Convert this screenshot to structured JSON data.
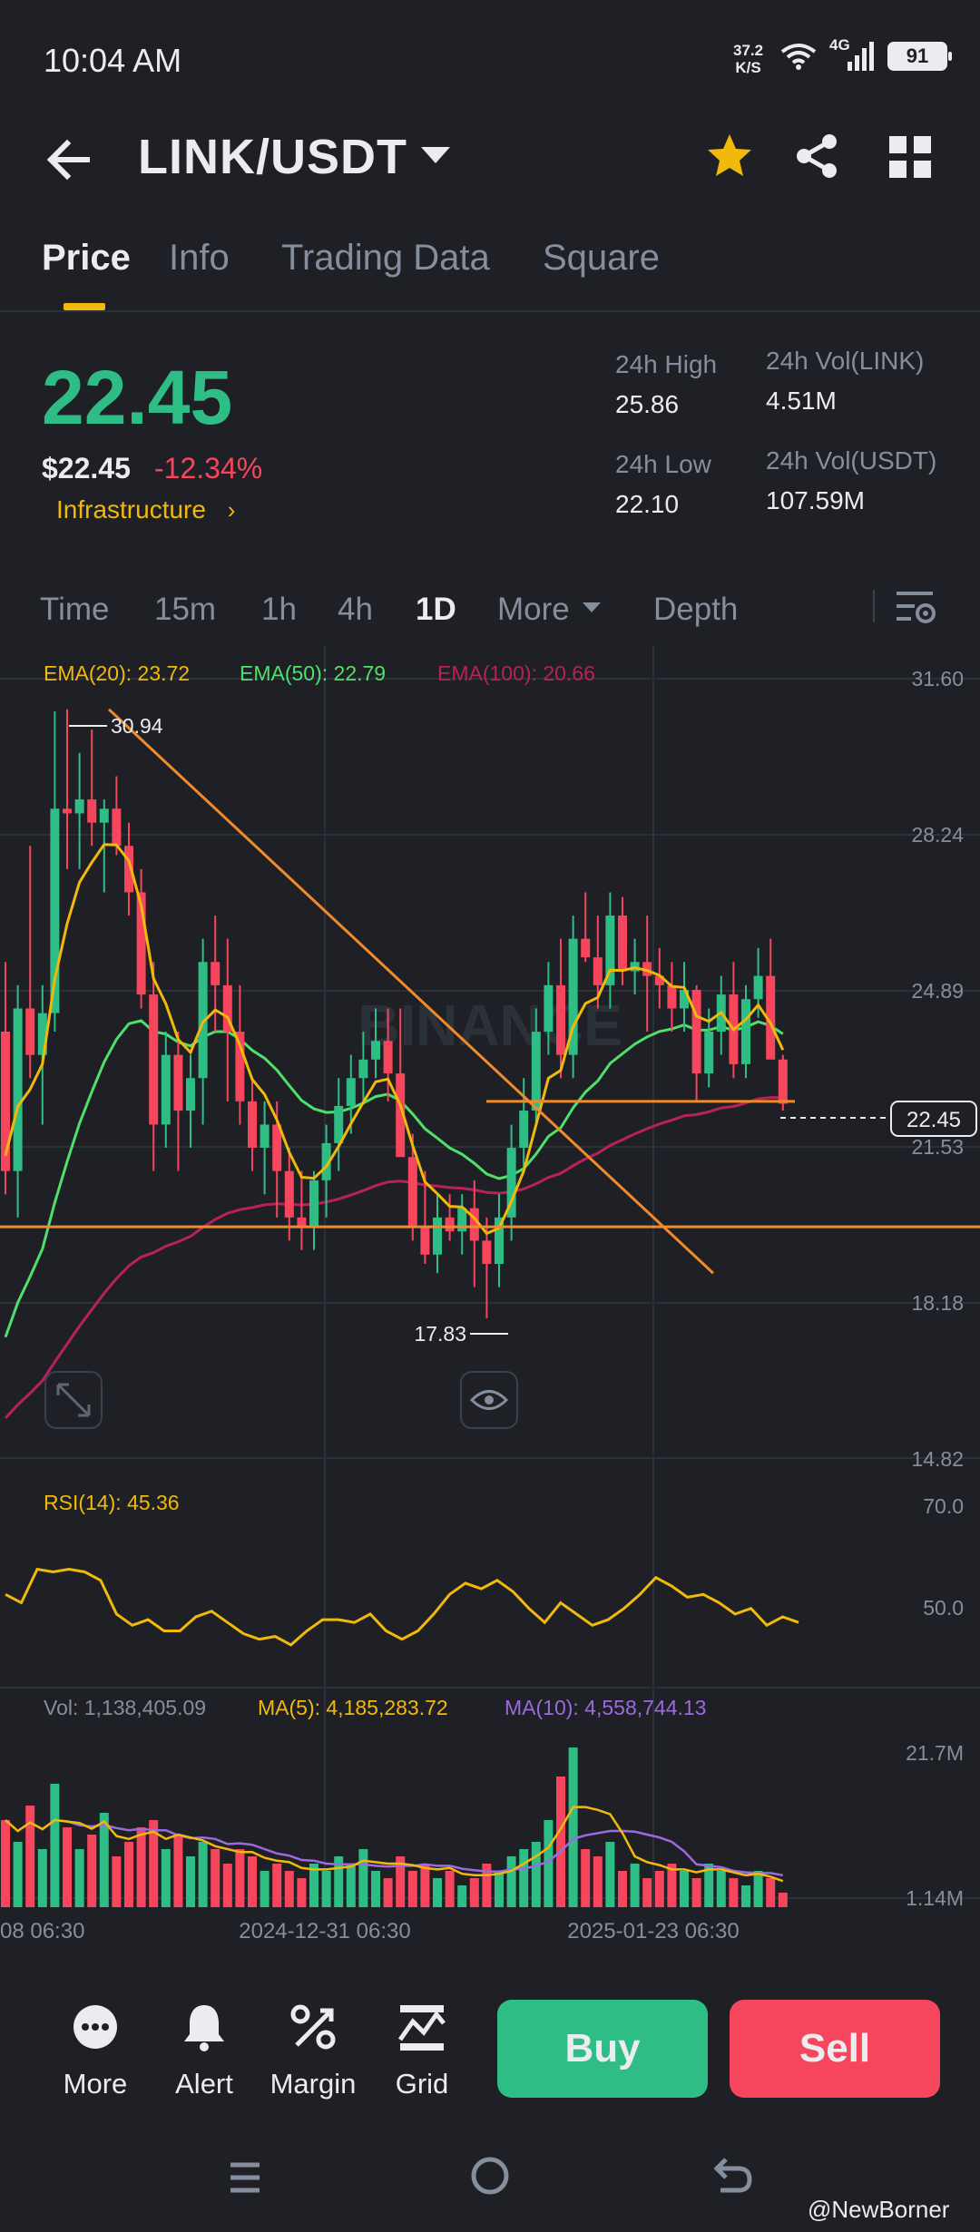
{
  "status_bar": {
    "time": "10:04 AM",
    "net_speed_value": "37.2",
    "net_speed_unit": "K/S",
    "network": "4G",
    "battery": "91",
    "icons": [
      "wifi-icon",
      "signal-icon",
      "battery-icon"
    ]
  },
  "header": {
    "pair": "LINK/USDT",
    "icons": [
      "back-arrow-icon",
      "caret-down-icon",
      "star-icon",
      "share-icon",
      "grid-icon"
    ],
    "favorite_color": "#f0b90b"
  },
  "tabs": [
    {
      "label": "Price",
      "active": true
    },
    {
      "label": "Info"
    },
    {
      "label": "Trading Data"
    },
    {
      "label": "Square"
    }
  ],
  "price": {
    "last": "22.45",
    "usd": "$22.45",
    "change": "-12.34%",
    "category": "Infrastructure"
  },
  "stats": {
    "high_label": "24h High",
    "high": "25.86",
    "low_label": "24h Low",
    "low": "22.10",
    "vol_link_label": "24h Vol(LINK)",
    "vol_link": "4.51M",
    "vol_usdt_label": "24h Vol(USDT)",
    "vol_usdt": "107.59M"
  },
  "intervals": {
    "items": [
      "Time",
      "15m",
      "1h",
      "4h",
      "1D",
      "More",
      "Depth"
    ],
    "active": "1D"
  },
  "colors": {
    "up": "#2ebd85",
    "down": "#f6465d",
    "accent": "#f0b90b",
    "ema20": "#f0b90b",
    "ema50": "#4ee06a",
    "ema100": "#b8215a",
    "rsi": "#f0b90b",
    "ma10": "#9c6ade",
    "trendline": "#f28a2b"
  },
  "indicators": {
    "ema20": "EMA(20): 23.72",
    "ema50": "EMA(50): 22.79",
    "ema100": "EMA(100): 20.66",
    "rsi": "RSI(14): 45.36",
    "vol": "Vol: 1,138,405.09",
    "ma5": "MA(5): 4,185,283.72",
    "ma10": "MA(10): 4,558,744.13"
  },
  "chart_labels": {
    "price_axis": [
      "31.60",
      "28.24",
      "24.89",
      "21.53",
      "18.18",
      "14.82"
    ],
    "current_price": "22.45",
    "high_marker": "30.94",
    "low_marker": "17.83",
    "rsi_axis": [
      "70.0",
      "50.0"
    ],
    "vol_axis": [
      "21.7M",
      "1.14M"
    ],
    "time_axis": [
      "08 06:30",
      "2024-12-31 06:30",
      "2025-01-23 06:30"
    ],
    "watermark": "BINANCE"
  },
  "chart_data": {
    "type": "candlestick",
    "title": "LINK/USDT 1D",
    "ylim": [
      14.82,
      31.6
    ],
    "x": [
      "08 06:30",
      "2024-12-31 06:30",
      "2025-01-23 06:30"
    ],
    "candles": [
      [
        24.0,
        25.5,
        20.5,
        21.0
      ],
      [
        21.0,
        25.0,
        20.0,
        24.5
      ],
      [
        24.5,
        28.0,
        23.0,
        23.5
      ],
      [
        23.5,
        25.0,
        22.0,
        24.4
      ],
      [
        24.4,
        30.9,
        24.0,
        28.8
      ],
      [
        28.8,
        30.94,
        27.5,
        28.7
      ],
      [
        28.7,
        30.0,
        27.5,
        29.0
      ],
      [
        29.0,
        30.5,
        28.0,
        28.5
      ],
      [
        28.5,
        29.0,
        27.0,
        28.8
      ],
      [
        28.8,
        29.5,
        27.8,
        28.0
      ],
      [
        28.0,
        28.5,
        26.5,
        27.0
      ],
      [
        27.0,
        27.5,
        24.5,
        24.8
      ],
      [
        24.8,
        25.5,
        21.0,
        22.0
      ],
      [
        22.0,
        24.0,
        21.5,
        23.5
      ],
      [
        23.5,
        24.0,
        21.0,
        22.3
      ],
      [
        22.3,
        23.5,
        21.5,
        23.0
      ],
      [
        23.0,
        26.0,
        22.0,
        25.5
      ],
      [
        25.5,
        26.5,
        24.0,
        25.0
      ],
      [
        25.0,
        26.0,
        22.5,
        24.0
      ],
      [
        24.0,
        25.0,
        22.0,
        22.5
      ],
      [
        22.5,
        23.0,
        21.0,
        21.5
      ],
      [
        21.5,
        22.5,
        20.5,
        22.0
      ],
      [
        22.0,
        22.5,
        20.0,
        21.0
      ],
      [
        21.0,
        21.5,
        19.5,
        20.0
      ],
      [
        20.0,
        21.0,
        19.3,
        19.8
      ],
      [
        19.8,
        21.0,
        19.3,
        20.8
      ],
      [
        20.8,
        22.0,
        20.0,
        21.6
      ],
      [
        21.6,
        23.0,
        21.0,
        22.4
      ],
      [
        22.4,
        23.5,
        21.8,
        23.0
      ],
      [
        23.0,
        24.0,
        22.5,
        23.4
      ],
      [
        23.4,
        24.5,
        23.0,
        23.8
      ],
      [
        23.8,
        24.5,
        22.5,
        23.1
      ],
      [
        23.1,
        24.5,
        22.0,
        21.3
      ],
      [
        21.3,
        21.8,
        19.5,
        19.8
      ],
      [
        19.8,
        21.0,
        19.0,
        19.2
      ],
      [
        19.2,
        20.5,
        18.8,
        20.0
      ],
      [
        20.0,
        20.5,
        19.5,
        19.7
      ],
      [
        19.7,
        20.5,
        19.2,
        20.2
      ],
      [
        20.2,
        20.8,
        18.5,
        19.5
      ],
      [
        19.5,
        20.0,
        17.83,
        19.0
      ],
      [
        19.0,
        20.5,
        18.5,
        20.0
      ],
      [
        20.0,
        22.0,
        19.5,
        21.5
      ],
      [
        21.5,
        23.0,
        21.0,
        22.3
      ],
      [
        22.3,
        24.5,
        22.0,
        24.0
      ],
      [
        24.0,
        25.5,
        23.5,
        25.0
      ],
      [
        25.0,
        26.0,
        23.0,
        23.5
      ],
      [
        23.5,
        26.5,
        23.0,
        26.0
      ],
      [
        26.0,
        27.0,
        25.5,
        25.6
      ],
      [
        25.6,
        26.5,
        24.5,
        25.0
      ],
      [
        25.0,
        27.0,
        24.5,
        26.5
      ],
      [
        26.5,
        26.9,
        25.0,
        25.3
      ],
      [
        25.3,
        26.0,
        24.8,
        25.5
      ],
      [
        25.5,
        26.5,
        24.0,
        25.2
      ],
      [
        25.2,
        25.8,
        24.5,
        25.0
      ],
      [
        25.0,
        25.5,
        24.0,
        24.5
      ],
      [
        24.5,
        25.5,
        24.0,
        24.9
      ],
      [
        24.9,
        25.0,
        22.5,
        23.1
      ],
      [
        23.1,
        24.5,
        22.8,
        24.0
      ],
      [
        24.0,
        25.2,
        23.5,
        24.8
      ],
      [
        24.8,
        25.5,
        23.0,
        23.3
      ],
      [
        23.3,
        25.0,
        23.0,
        24.7
      ],
      [
        24.7,
        25.8,
        24.3,
        25.2
      ],
      [
        25.2,
        26.0,
        24.6,
        23.4
      ],
      [
        23.4,
        23.5,
        22.3,
        22.45
      ]
    ],
    "volumes": [
      12,
      9,
      14,
      8,
      17,
      11,
      8,
      10,
      13,
      7,
      9,
      11,
      12,
      8,
      10,
      7,
      9,
      8,
      6,
      8,
      7,
      5,
      6,
      5,
      4,
      6,
      5,
      7,
      6,
      8,
      5,
      4,
      7,
      5,
      6,
      4,
      5,
      3,
      4,
      6,
      5,
      7,
      8,
      9,
      12,
      18,
      22,
      8,
      7,
      9,
      5,
      6,
      4,
      5,
      6,
      5,
      4,
      6,
      5,
      4,
      3,
      5,
      4,
      2
    ],
    "rsi": [
      55,
      52,
      64,
      63,
      64,
      63,
      60,
      48,
      44,
      46,
      42,
      42,
      47,
      49,
      45,
      41,
      39,
      40,
      37,
      42,
      46,
      46,
      45,
      48,
      42,
      39,
      42,
      48,
      55,
      59,
      57,
      60,
      56,
      50,
      45,
      52,
      48,
      44,
      46,
      50,
      55,
      61,
      58,
      54,
      55,
      52,
      48,
      50,
      44,
      47,
      45
    ],
    "series": [
      {
        "name": "EMA(20)",
        "last": 23.72
      },
      {
        "name": "EMA(50)",
        "last": 22.79
      },
      {
        "name": "EMA(100)",
        "last": 20.66
      }
    ]
  },
  "bottom_bar": {
    "actions": [
      {
        "label": "More",
        "icon": "more-dots-icon"
      },
      {
        "label": "Alert",
        "icon": "bell-icon"
      },
      {
        "label": "Margin",
        "icon": "margin-icon"
      },
      {
        "label": "Grid",
        "icon": "grid-trading-icon"
      }
    ],
    "buy": "Buy",
    "sell": "Sell",
    "watermark": "@NewBorner"
  }
}
